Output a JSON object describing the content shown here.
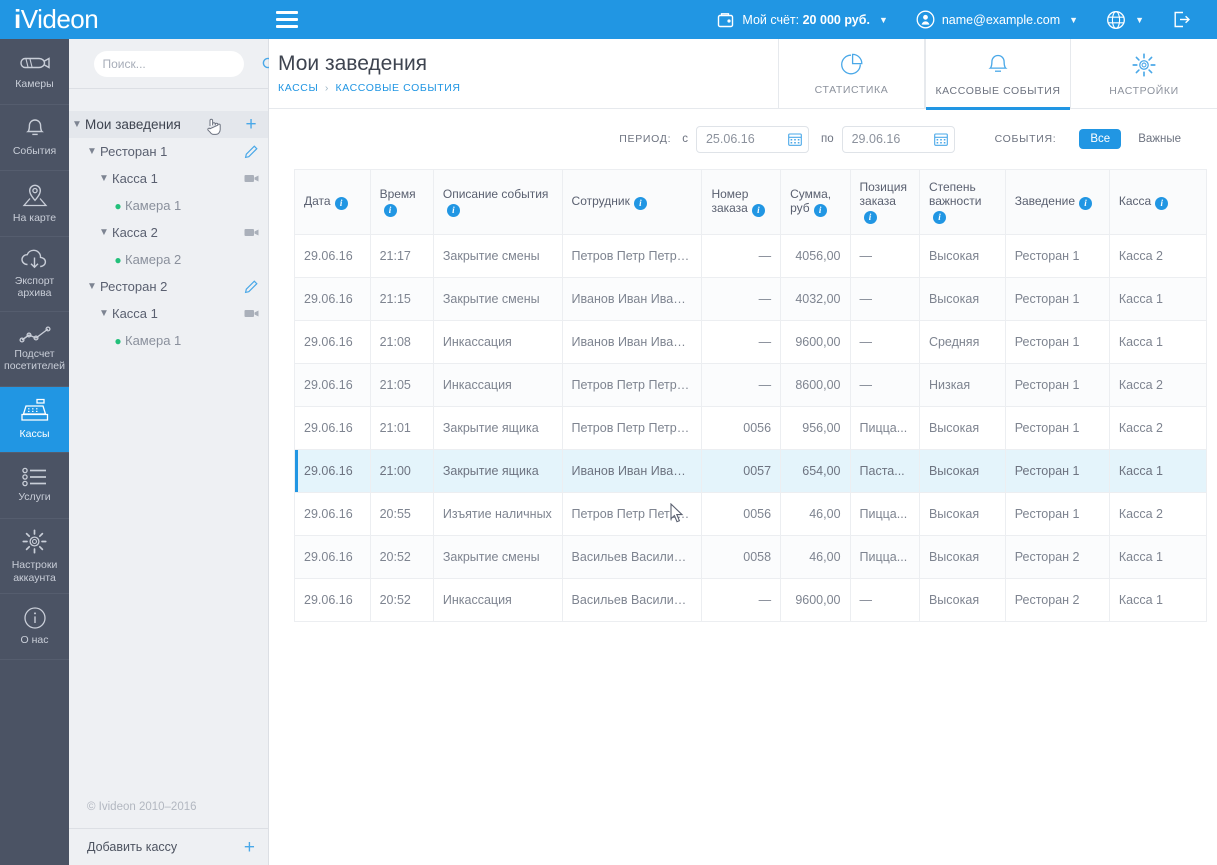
{
  "brand": {
    "name_i": "i",
    "name_rest": "Videon",
    "accent": "#2196e3",
    "rail_bg": "#4b5364"
  },
  "topbar": {
    "hamburger": "menu-icon",
    "account": {
      "label_prefix": "Мой счёт: ",
      "amount": "20 000 руб.",
      "icon": "wallet-icon"
    },
    "user": {
      "email": "name@example.com",
      "icon": "user-avatar-icon"
    },
    "language": {
      "icon": "globe-icon"
    },
    "logout": {
      "icon": "logout-icon"
    }
  },
  "rail": {
    "items": [
      {
        "label": "Камеры",
        "icon": "camera-icon",
        "active": false
      },
      {
        "label": "События",
        "icon": "bell-icon",
        "active": false
      },
      {
        "label": "На карте",
        "icon": "map-pin-icon",
        "active": false
      },
      {
        "label": "Экспорт\nархива",
        "l1": "Экспорт",
        "l2": "архива",
        "icon": "cloud-download-icon",
        "active": false
      },
      {
        "label": "Подсчет\nпосетителей",
        "l1": "Подсчет",
        "l2": "посетителей",
        "icon": "line-chart-icon",
        "active": false
      },
      {
        "label": "Кассы",
        "icon": "cash-register-icon",
        "active": true
      },
      {
        "label": "Услуги",
        "icon": "list-icon",
        "active": false
      },
      {
        "label": "Настроки\nаккаунта",
        "l1": "Настроки",
        "l2": "аккаунта",
        "icon": "gear-icon",
        "active": false
      },
      {
        "label": "О нас",
        "icon": "info-circle-icon",
        "active": false
      }
    ]
  },
  "sidebar": {
    "search": {
      "placeholder": "Поиск...",
      "value": "",
      "icon": "search-icon"
    },
    "tree": [
      {
        "label": "Мои заведения",
        "level": 0,
        "expanded": true,
        "action": "add-icon"
      },
      {
        "label": "Ресторан 1",
        "level": 1,
        "expanded": true,
        "action": "edit-pencil-icon"
      },
      {
        "label": "Касса 1",
        "level": 2,
        "expanded": true,
        "action": "videocam-icon"
      },
      {
        "label": "Камера 1",
        "level": 3,
        "status": "online",
        "action": ""
      },
      {
        "label": "Касса 2",
        "level": 2,
        "expanded": true,
        "action": "videocam-icon"
      },
      {
        "label": "Камера 2",
        "level": 3,
        "status": "online",
        "action": ""
      },
      {
        "label": "Ресторан 2",
        "level": 1,
        "expanded": true,
        "action": "edit-pencil-icon"
      },
      {
        "label": "Касса 1",
        "level": 2,
        "expanded": true,
        "action": "videocam-icon"
      },
      {
        "label": "Камера 1",
        "level": 3,
        "status": "online",
        "action": ""
      }
    ],
    "copyright": "© Ivideon 2010–2016",
    "add_cash_register": "Добавить кассу"
  },
  "page": {
    "title": "Мои заведения",
    "breadcrumbs": [
      "КАССЫ",
      "КАССОВЫЕ СОБЫТИЯ"
    ],
    "breadcrumb_sep": "›",
    "tabs": [
      {
        "label": "СТАТИСТИКА",
        "icon": "pie-chart-icon",
        "active": false
      },
      {
        "label": "КАССОВЫЕ СОБЫТИЯ",
        "icon": "bell-icon",
        "active": true
      },
      {
        "label": "НАСТРОЙКИ",
        "icon": "gear-icon",
        "active": false
      }
    ]
  },
  "filters": {
    "period_label": "ПЕРИОД:",
    "from_label": "с",
    "from_value": "25.06.16",
    "to_label": "по",
    "to_value": "29.06.16",
    "calendar_icon": "calendar-icon",
    "events_label": "СОБЫТИЯ:",
    "segments": [
      {
        "label": "Все",
        "on": true
      },
      {
        "label": "Важные",
        "on": false
      }
    ]
  },
  "table": {
    "columns": [
      {
        "label": "Дата",
        "info": true
      },
      {
        "label": "Время",
        "info": true
      },
      {
        "label": "Описание события",
        "info": true
      },
      {
        "label": "Сотрудник",
        "info": true
      },
      {
        "label": "Номер заказа",
        "info": true
      },
      {
        "label": "Сумма, руб",
        "info": true
      },
      {
        "label": "Позиция заказа",
        "info": true
      },
      {
        "label": "Степень важности",
        "info": true
      },
      {
        "label": "Заведение",
        "info": true
      },
      {
        "label": "Касса",
        "info": true
      }
    ],
    "rows": [
      {
        "date": "29.06.16",
        "time": "21:17",
        "event": "Закрытие смены",
        "employee": "Петров Петр Петрович",
        "order": "—",
        "sum": "4056,00",
        "position": "—",
        "severity": "Высокая",
        "venue": "Ресторан 1",
        "register": "Касса 2",
        "selected": false
      },
      {
        "date": "29.06.16",
        "time": "21:15",
        "event": "Закрытие смены",
        "employee": "Иванов Иван Иванович",
        "order": "—",
        "sum": "4032,00",
        "position": "—",
        "severity": "Высокая",
        "venue": "Ресторан 1",
        "register": "Касса 1",
        "selected": false
      },
      {
        "date": "29.06.16",
        "time": "21:08",
        "event": "Инкассация",
        "employee": "Иванов Иван Иванович",
        "order": "—",
        "sum": "9600,00",
        "position": "—",
        "severity": "Средняя",
        "venue": "Ресторан 1",
        "register": "Касса 1",
        "selected": false
      },
      {
        "date": "29.06.16",
        "time": "21:05",
        "event": "Инкассация",
        "employee": "Петров Петр Петрович",
        "order": "—",
        "sum": "8600,00",
        "position": "—",
        "severity": "Низкая",
        "venue": "Ресторан 1",
        "register": "Касса 2",
        "selected": false
      },
      {
        "date": "29.06.16",
        "time": "21:01",
        "event": "Закрытие ящика",
        "employee": "Петров Петр Петрович",
        "order": "0056",
        "sum": "956,00",
        "position": "Пицца...",
        "severity": "Высокая",
        "venue": "Ресторан 1",
        "register": "Касса 2",
        "selected": false
      },
      {
        "date": "29.06.16",
        "time": "21:00",
        "event": "Закрытие ящика",
        "employee": "Иванов Иван Иванович",
        "order": "0057",
        "sum": "654,00",
        "position": "Паста...",
        "severity": "Высокая",
        "venue": "Ресторан 1",
        "register": "Касса 1",
        "selected": true
      },
      {
        "date": "29.06.16",
        "time": "20:55",
        "event": "Изъятие наличных",
        "employee": "Петров Петр Петрович",
        "order": "0056",
        "sum": "46,00",
        "position": "Пицца...",
        "severity": "Высокая",
        "venue": "Ресторан 1",
        "register": "Касса 2",
        "selected": false
      },
      {
        "date": "29.06.16",
        "time": "20:52",
        "event": "Закрытие смены",
        "employee": "Васильев Василий Ва...",
        "order": "0058",
        "sum": "46,00",
        "position": "Пицца...",
        "severity": "Высокая",
        "venue": "Ресторан 2",
        "register": "Касса 1",
        "selected": false
      },
      {
        "date": "29.06.16",
        "time": "20:52",
        "event": "Инкассация",
        "employee": "Васильев Василий Ва...",
        "order": "—",
        "sum": "9600,00",
        "position": "—",
        "severity": "Высокая",
        "venue": "Ресторан 2",
        "register": "Касса 1",
        "selected": false
      }
    ]
  }
}
